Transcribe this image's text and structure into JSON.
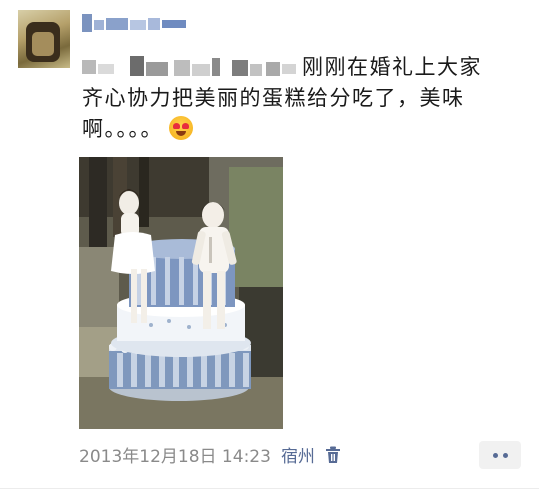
{
  "post": {
    "text_line1": "刚刚在婚礼上大家",
    "text_line2": "齐心协力把美丽的蛋糕给分吃了，美味",
    "text_line3": "啊。。。。",
    "emoji": "heart-eyes-emoji",
    "timestamp": "2013年12月18日 14:23",
    "location": "宿州"
  },
  "icons": {
    "delete": "trash-icon",
    "more": "more-dots-icon"
  },
  "colors": {
    "link": "#576b95",
    "meta_text": "#8a8a8a",
    "more_button_bg": "#f1f1f1"
  }
}
